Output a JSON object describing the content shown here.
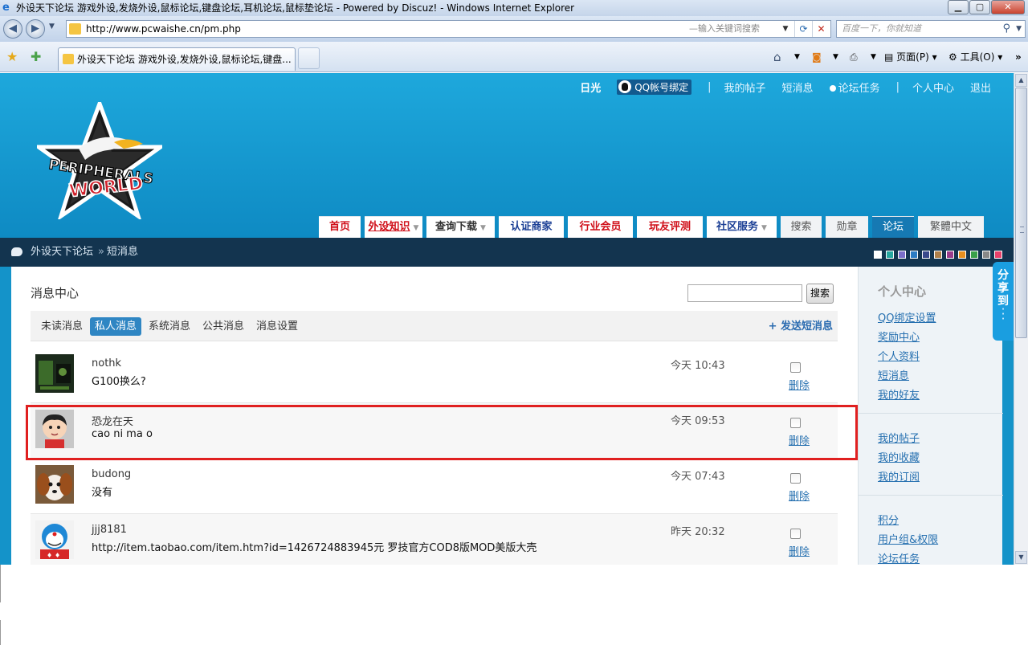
{
  "window": {
    "title": "外设天下论坛 游戏外设,发烧外设,鼠标论坛,键盘论坛,耳机论坛,鼠标垫论坛 - Powered by Discuz! - Windows Internet Explorer",
    "min_icon": "minimize-icon",
    "max_icon": "maximize-icon",
    "close_icon": "close-icon"
  },
  "address": {
    "url": "http://www.pcwaishe.cn/pm.php",
    "hint": "—输入关键词搜索",
    "search_placeholder": "百度一下，你就知道"
  },
  "tabbar": {
    "tab_title": "外设天下论坛 游戏外设,发烧外设,鼠标论坛,键盘...",
    "page_label": "页面(P)",
    "tools_label": "工具(O)"
  },
  "toplinks": {
    "username": "日光",
    "qq_bind": "QQ帐号绑定",
    "sep": "|",
    "my_posts": "我的帖子",
    "pm": "短消息",
    "tasks": "论坛任务",
    "sep2": "|",
    "profile": "个人中心",
    "logout": "退出"
  },
  "nav": [
    {
      "label": "首页"
    },
    {
      "label": "外设知识"
    },
    {
      "label": "查询下载"
    },
    {
      "label": "认证商家"
    },
    {
      "label": "行业会员"
    },
    {
      "label": "玩友评测"
    },
    {
      "label": "社区服务"
    },
    {
      "label": "搜索"
    },
    {
      "label": "勋章"
    },
    {
      "label": "论坛"
    },
    {
      "label": "繁體中文"
    }
  ],
  "breadcrumb": {
    "forum": "外设天下论坛",
    "sep": "»",
    "current": "短消息"
  },
  "theme_colors": [
    "#ffffff",
    "#26a6a0",
    "#7b6fc9",
    "#2c7cc4",
    "#3b4a8c",
    "#b0804a",
    "#9a3c8c",
    "#e89020",
    "#3aa04a",
    "#888888",
    "#e8406a"
  ],
  "message_center": {
    "title": "消息中心",
    "search_button": "搜索",
    "tabs": [
      "未读消息",
      "私人消息",
      "系统消息",
      "公共消息",
      "消息设置"
    ],
    "active_tab": "私人消息",
    "send": "+ 发送短消息",
    "delete_label": "删除",
    "messages": [
      {
        "from": "nothk",
        "text": "G100换么?",
        "time": "今天  10:43"
      },
      {
        "from": "恐龙在天",
        "text": "cao ni ma o",
        "time": "今天  09:53"
      },
      {
        "from": "budong",
        "text": "没有",
        "time": "今天  07:43"
      },
      {
        "from": "jjj8181",
        "text": "http://item.taobao.com/item.htm?id=1426724883945元  罗技官方COD8版MOD美版大壳",
        "time": "昨天  20:32"
      }
    ]
  },
  "sidebar": {
    "title": "个人中心",
    "group1": [
      "QQ绑定设置",
      "奖励中心",
      "个人资料",
      "短消息",
      "我的好友"
    ],
    "group2": [
      "我的帖子",
      "我的收藏",
      "我的订阅"
    ],
    "group3": [
      "积分",
      "用户组&权限",
      "论坛任务"
    ]
  },
  "share": {
    "label_1": "分",
    "label_2": "享",
    "label_3": "到"
  }
}
